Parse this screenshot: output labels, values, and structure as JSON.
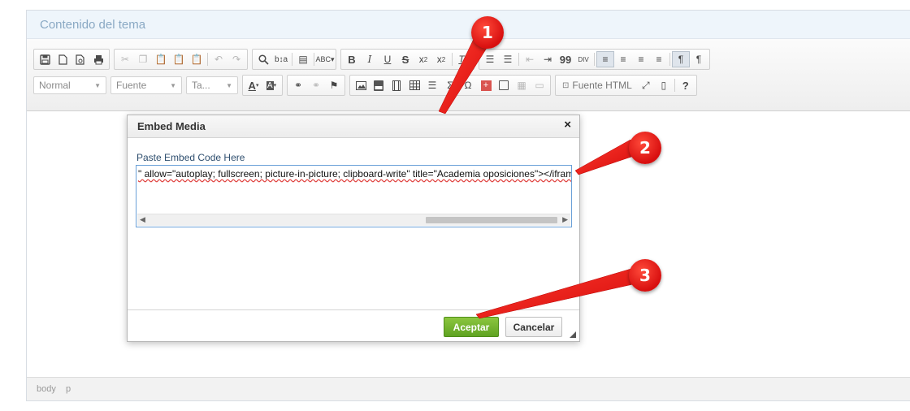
{
  "editor": {
    "title": "Contenido del tema",
    "toolbar": {
      "format_combo": "Normal",
      "font_combo": "Fuente",
      "size_combo": "Ta...",
      "source_button": "Fuente HTML",
      "help_button": "?"
    },
    "status": {
      "path": [
        "body",
        "p"
      ]
    }
  },
  "dialog": {
    "title": "Embed Media",
    "close": "×",
    "label": "Paste Embed Code Here",
    "code": "\" allow=\"autoplay; fullscreen; picture-in-picture; clipboard-write\" title=\"Academia oposiciones\"></iframe>",
    "ok_button": "Aceptar",
    "cancel_button": "Cancelar"
  },
  "callouts": [
    "1",
    "2",
    "3"
  ],
  "colors": {
    "accent_green": "#6cb22f",
    "callout_red": "#e01e1e",
    "header_bg": "#eef5fb"
  }
}
